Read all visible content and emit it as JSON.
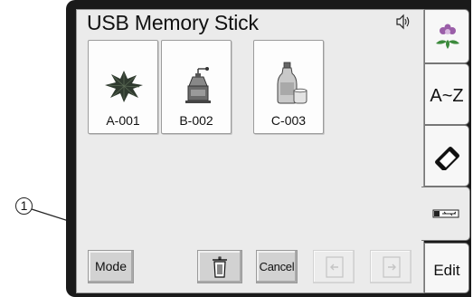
{
  "header": {
    "title": "USB Memory Stick",
    "speaker_icon": "speaker-icon"
  },
  "patterns": [
    {
      "label": "A-001",
      "icon": "leaf-motif-icon"
    },
    {
      "label": "B-002",
      "icon": "coffee-grinder-icon"
    },
    {
      "label": "C-003",
      "icon": "bottle-and-cup-icon"
    }
  ],
  "sidebar": {
    "tabs": [
      {
        "name": "pattern-tab",
        "icon": "flower-icon"
      },
      {
        "name": "alphabet-tab",
        "label": "A~Z"
      },
      {
        "name": "eraser-tab",
        "icon": "eraser-icon"
      },
      {
        "name": "usb-tab",
        "icon": "usb-icon",
        "active": true
      },
      {
        "name": "edit-tab",
        "label": "Edit"
      }
    ]
  },
  "toolbar": {
    "mode_label": "Mode",
    "delete_icon": "trash-icon",
    "cancel_label": "Cancel",
    "prev_icon": "page-prev-icon",
    "next_icon": "page-next-icon"
  },
  "callout": {
    "number": "1"
  }
}
